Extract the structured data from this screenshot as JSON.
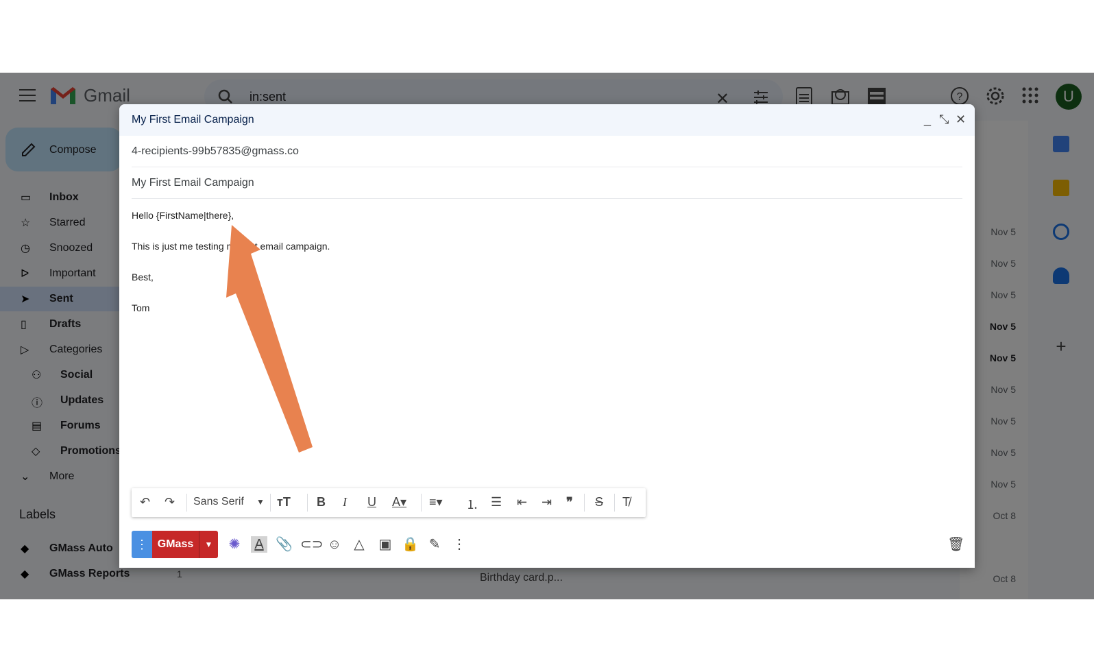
{
  "app": {
    "name": "Gmail",
    "search_query": "in:sent",
    "avatar_letter": "U"
  },
  "sidebar": {
    "compose_label": "Compose",
    "items": [
      {
        "label": "Inbox",
        "icon": "inbox-icon",
        "bold": true
      },
      {
        "label": "Starred",
        "icon": "star-icon",
        "bold": false
      },
      {
        "label": "Snoozed",
        "icon": "clock-icon",
        "bold": false
      },
      {
        "label": "Important",
        "icon": "important-icon",
        "bold": false
      },
      {
        "label": "Sent",
        "icon": "send-icon",
        "bold": true,
        "selected": true
      },
      {
        "label": "Drafts",
        "icon": "draft-icon",
        "bold": true
      },
      {
        "label": "Categories",
        "icon": "label-icon",
        "bold": false
      }
    ],
    "categories": [
      {
        "label": "Social",
        "icon": "people-icon"
      },
      {
        "label": "Updates",
        "icon": "info-icon"
      },
      {
        "label": "Forums",
        "icon": "forum-icon"
      },
      {
        "label": "Promotions",
        "icon": "tag-icon"
      }
    ],
    "more_label": "More",
    "labels_heading": "Labels",
    "labels": [
      {
        "label": "GMass Auto",
        "count": ""
      },
      {
        "label": "GMass Reports",
        "count": "1"
      }
    ]
  },
  "list": {
    "dates": [
      {
        "text": "Nov 5",
        "bold": false
      },
      {
        "text": "Nov 5",
        "bold": false
      },
      {
        "text": "Nov 5",
        "bold": false
      },
      {
        "text": "Nov 5",
        "bold": true
      },
      {
        "text": "Nov 5",
        "bold": true
      },
      {
        "text": "Nov 5",
        "bold": false
      },
      {
        "text": "Nov 5",
        "bold": false
      },
      {
        "text": "Nov 5",
        "bold": false
      },
      {
        "text": "Nov 5",
        "bold": false
      },
      {
        "text": "Oct 8",
        "bold": false
      },
      {
        "text": "Oct 8",
        "bold": false
      }
    ],
    "attachment_chip": "Birthday card.p..."
  },
  "compose": {
    "title": "My First Email Campaign",
    "to": "4-recipients-99b57835@gmass.co",
    "subject": "My First Email Campaign",
    "body": [
      "Hello {FirstName|there},",
      "This is just me testing my first email campaign.",
      "Best,",
      "Tom"
    ],
    "format_font": "Sans Serif",
    "send_label": "GMass"
  },
  "colors": {
    "gmass_red": "#c62828",
    "accent_blue": "#4a90e2",
    "arrow": "#e8824f"
  }
}
